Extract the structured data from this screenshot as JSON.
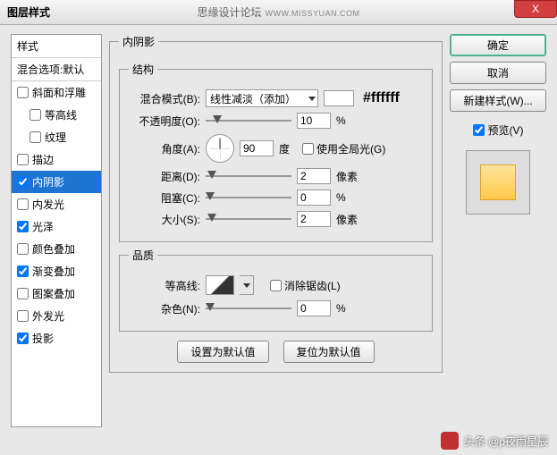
{
  "titlebar": {
    "title": "图层样式",
    "forum": "思缘设计论坛",
    "url": "WWW.MISSYUAN.COM",
    "close": "X"
  },
  "styles": {
    "header": "样式",
    "blend": "混合选项:默认",
    "items": [
      {
        "label": "斜面和浮雕",
        "checked": false,
        "indent": false
      },
      {
        "label": "等高线",
        "checked": false,
        "indent": true
      },
      {
        "label": "纹理",
        "checked": false,
        "indent": true
      },
      {
        "label": "描边",
        "checked": false,
        "indent": false
      },
      {
        "label": "内阴影",
        "checked": true,
        "indent": false,
        "selected": true
      },
      {
        "label": "内发光",
        "checked": false,
        "indent": false
      },
      {
        "label": "光泽",
        "checked": true,
        "indent": false
      },
      {
        "label": "颜色叠加",
        "checked": false,
        "indent": false
      },
      {
        "label": "渐变叠加",
        "checked": true,
        "indent": false
      },
      {
        "label": "图案叠加",
        "checked": false,
        "indent": false
      },
      {
        "label": "外发光",
        "checked": false,
        "indent": false
      },
      {
        "label": "投影",
        "checked": true,
        "indent": false
      }
    ]
  },
  "main": {
    "title": "内阴影",
    "structure": {
      "legend": "结构",
      "blend_label": "混合模式(B):",
      "blend_value": "线性减淡（添加）",
      "hex": "#ffffff",
      "opacity_label": "不透明度(O):",
      "opacity_value": "10",
      "opacity_unit": "%",
      "angle_label": "角度(A):",
      "angle_value": "90",
      "angle_unit": "度",
      "global_label": "使用全局光(G)",
      "distance_label": "距离(D):",
      "distance_value": "2",
      "distance_unit": "像素",
      "choke_label": "阻塞(C):",
      "choke_value": "0",
      "choke_unit": "%",
      "size_label": "大小(S):",
      "size_value": "2",
      "size_unit": "像素"
    },
    "quality": {
      "legend": "品质",
      "contour_label": "等高线:",
      "anti_label": "消除锯齿(L)",
      "noise_label": "杂色(N):",
      "noise_value": "0",
      "noise_unit": "%"
    },
    "buttons": {
      "default": "设置为默认值",
      "reset": "复位为默认值"
    }
  },
  "right": {
    "ok": "确定",
    "cancel": "取消",
    "newstyle": "新建样式(W)...",
    "preview": "预览(V)"
  },
  "watermark": "头条 @p夜雨星辰"
}
